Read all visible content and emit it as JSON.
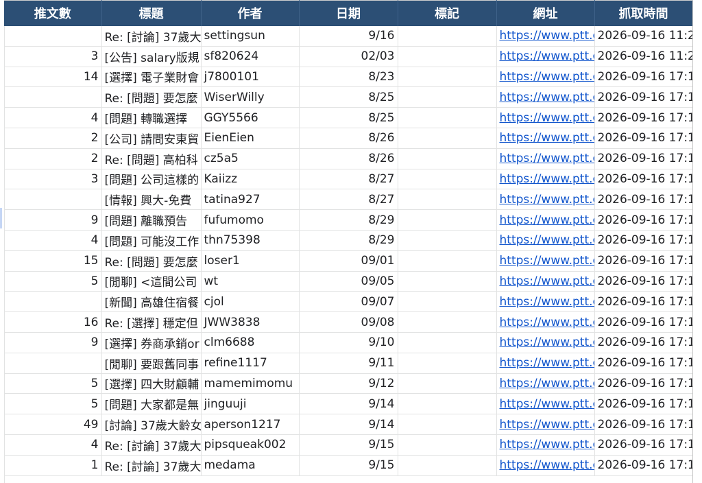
{
  "columns": [
    "推文數",
    "標題",
    "作者",
    "日期",
    "標記",
    "網址",
    "抓取時間"
  ],
  "rows": [
    {
      "push": "",
      "title": "Re: [討論] 37歲大",
      "author": "settingsun",
      "date": "9/16",
      "mark": "",
      "url": "https://www.ptt.c",
      "fetched": "2026-09-16 11:2"
    },
    {
      "push": "3",
      "title": "[公告] salary版規",
      "author": "sf820624",
      "date": "02/03",
      "mark": "",
      "url": "https://www.ptt.c",
      "fetched": "2026-09-16 11:2"
    },
    {
      "push": "14",
      "title": "[選擇] 電子業財會",
      "author": "j7800101",
      "date": "8/23",
      "mark": "",
      "url": "https://www.ptt.c",
      "fetched": "2026-09-16 17:1"
    },
    {
      "push": "",
      "title": "Re: [問題] 要怎麼",
      "author": "WiserWilly",
      "date": "8/25",
      "mark": "",
      "url": "https://www.ptt.c",
      "fetched": "2026-09-16 17:1"
    },
    {
      "push": "4",
      "title": "[問題] 轉職選擇",
      "author": "GGY5566",
      "date": "8/25",
      "mark": "",
      "url": "https://www.ptt.c",
      "fetched": "2026-09-16 17:1"
    },
    {
      "push": "2",
      "title": "[公司] 請問安東貿",
      "author": "EienEien",
      "date": "8/26",
      "mark": "",
      "url": "https://www.ptt.c",
      "fetched": "2026-09-16 17:1"
    },
    {
      "push": "2",
      "title": "Re: [問題] 高柏科",
      "author": "cz5a5",
      "date": "8/26",
      "mark": "",
      "url": "https://www.ptt.c",
      "fetched": "2026-09-16 17:1"
    },
    {
      "push": "3",
      "title": "[問題] 公司這樣的",
      "author": "Kaiizz",
      "date": "8/27",
      "mark": "",
      "url": "https://www.ptt.c",
      "fetched": "2026-09-16 17:1"
    },
    {
      "push": "",
      "title": "[情報] 興大-免費",
      "author": "tatina927",
      "date": "8/27",
      "mark": "",
      "url": "https://www.ptt.c",
      "fetched": "2026-09-16 17:1"
    },
    {
      "push": "9",
      "title": "[問題] 離職預告",
      "author": "fufumomo",
      "date": "8/29",
      "mark": "",
      "url": "https://www.ptt.c",
      "fetched": "2026-09-16 17:1"
    },
    {
      "push": "4",
      "title": "[問題] 可能沒工作",
      "author": "thn75398",
      "date": "8/29",
      "mark": "",
      "url": "https://www.ptt.c",
      "fetched": "2026-09-16 17:1"
    },
    {
      "push": "15",
      "title": "Re: [問題] 要怎麼",
      "author": "loser1",
      "date": "09/01",
      "mark": "",
      "url": "https://www.ptt.c",
      "fetched": "2026-09-16 17:1"
    },
    {
      "push": "5",
      "title": "[閒聊] <這間公司",
      "author": "wt",
      "date": "09/05",
      "mark": "",
      "url": "https://www.ptt.c",
      "fetched": "2026-09-16 17:1"
    },
    {
      "push": "",
      "title": "[新聞] 高雄住宿餐",
      "author": "cjol",
      "date": "09/07",
      "mark": "",
      "url": "https://www.ptt.c",
      "fetched": "2026-09-16 17:1"
    },
    {
      "push": "16",
      "title": "Re: [選擇] 穩定但",
      "author": "JWW3838",
      "date": "09/08",
      "mark": "",
      "url": "https://www.ptt.c",
      "fetched": "2026-09-16 17:1"
    },
    {
      "push": "9",
      "title": "[選擇] 券商承銷or",
      "author": "clm6688",
      "date": "9/10",
      "mark": "",
      "url": "https://www.ptt.c",
      "fetched": "2026-09-16 17:1"
    },
    {
      "push": "",
      "title": "[閒聊] 要跟舊同事",
      "author": "refine1117",
      "date": "9/11",
      "mark": "",
      "url": "https://www.ptt.c",
      "fetched": "2026-09-16 17:1"
    },
    {
      "push": "5",
      "title": "[選擇] 四大財顧輔",
      "author": "mamemimomu",
      "date": "9/12",
      "mark": "",
      "url": "https://www.ptt.c",
      "fetched": "2026-09-16 17:1"
    },
    {
      "push": "5",
      "title": "[問題] 大家都是無",
      "author": "jinguuji",
      "date": "9/14",
      "mark": "",
      "url": "https://www.ptt.c",
      "fetched": "2026-09-16 17:1"
    },
    {
      "push": "49",
      "title": "[討論] 37歲大齡女",
      "author": "aperson1217",
      "date": "9/14",
      "mark": "",
      "url": "https://www.ptt.c",
      "fetched": "2026-09-16 17:1"
    },
    {
      "push": "4",
      "title": "Re: [討論] 37歲大",
      "author": "pipsqueak002",
      "date": "9/15",
      "mark": "",
      "url": "https://www.ptt.c",
      "fetched": "2026-09-16 17:1"
    },
    {
      "push": "1",
      "title": "Re: [討論] 37歲大",
      "author": "medama",
      "date": "9/15",
      "mark": "",
      "url": "https://www.ptt.c",
      "fetched": "2026-09-16 17:1"
    }
  ],
  "colors": {
    "header_bg": "#2c4f75",
    "header_text": "#ffffff",
    "link": "#1155cc",
    "grid": "#e2e3e3"
  }
}
